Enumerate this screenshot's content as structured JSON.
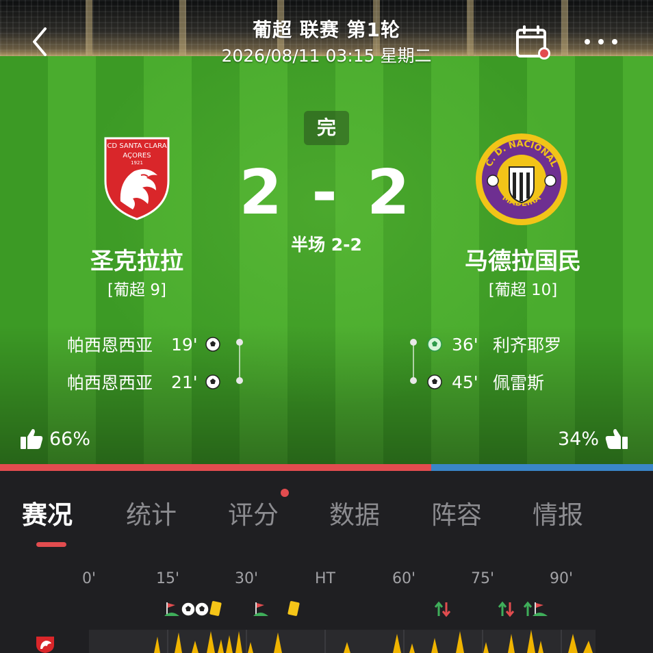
{
  "header": {
    "title": "葡超 联赛 第1轮",
    "datetime": "2026/08/11 03:15 星期二"
  },
  "match": {
    "status": "完",
    "score": "2 - 2",
    "halftime": "半场 2-2"
  },
  "home": {
    "name": "圣克拉拉",
    "rank": "[葡超 9]",
    "logo_top": "CD SANTA CLARA",
    "logo_mid": "AÇORES",
    "logo_year": "1921",
    "vote": "66%",
    "vote_value": 66,
    "color": "#e24c4f",
    "goals": [
      {
        "player": "帕西恩西亚",
        "minute": "19'"
      },
      {
        "player": "帕西恩西亚",
        "minute": "21'"
      }
    ]
  },
  "away": {
    "name": "马德拉国民",
    "rank": "[葡超 10]",
    "logo_top": "C. D. NACIONAL",
    "logo_bottom": "MADEIRA",
    "vote": "34%",
    "vote_value": 34,
    "color": "#3a86c8",
    "goals": [
      {
        "minute": "36'",
        "player": "利齐耶罗"
      },
      {
        "minute": "45'",
        "player": "佩雷斯"
      }
    ]
  },
  "tabs": [
    {
      "label": "赛况",
      "active": true
    },
    {
      "label": "统计"
    },
    {
      "label": "评分",
      "badge": true
    },
    {
      "label": "数据"
    },
    {
      "label": "阵容"
    },
    {
      "label": "情报"
    }
  ],
  "timeline": {
    "ticks": [
      "0'",
      "15'",
      "30'",
      "HT",
      "60'",
      "75'",
      "90'"
    ],
    "events": [
      {
        "type": "corner"
      },
      {
        "type": "goal"
      },
      {
        "type": "goal"
      },
      {
        "type": "yellow-card"
      },
      {
        "type": "corner"
      },
      {
        "type": "yellow-card"
      },
      {
        "type": "substitution"
      },
      {
        "type": "substitution"
      },
      {
        "type": "substitution"
      },
      {
        "type": "corner"
      }
    ]
  }
}
